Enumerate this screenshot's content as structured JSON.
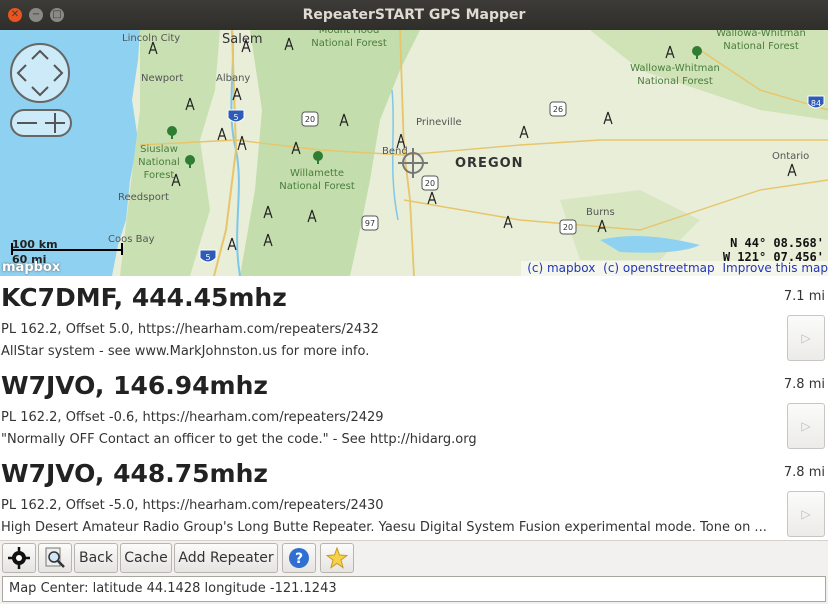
{
  "window": {
    "title": "RepeaterSTART GPS Mapper"
  },
  "map": {
    "labels": {
      "lincoln_city": "Lincoln City",
      "salem": "Salem",
      "newport": "Newport",
      "albany": "Albany",
      "siuslaw": "Siuslaw National Forest",
      "willamette": "Willamette National Forest",
      "mt_hood": "Mount Hood National Forest",
      "wallowa_whitman_top": "Wallowa-Whitman National Forest",
      "wallowa_whitman": "Wallowa-Whitman National Forest",
      "prineville": "Prineville",
      "bend": "Bend",
      "oregon": "OREGON",
      "reedsport": "Reedsport",
      "coos_bay": "Coos Bay",
      "burns": "Burns",
      "ontario": "Ontario"
    },
    "highways": [
      "5",
      "20",
      "26",
      "84",
      "20",
      "97",
      "20",
      "5"
    ],
    "scale_km": "100 km",
    "scale_mi": "60 mi",
    "logo": "mapbox",
    "latitude_text": "N 44° 08.568'",
    "longitude_text": "W 121° 07.456'",
    "attribution": {
      "mapbox": "(c) mapbox",
      "osm": "(c) openstreetmap",
      "improve": "Improve this map"
    }
  },
  "repeaters": [
    {
      "title": "KC7DMF, 444.45mhz",
      "distance": "7.1 mi",
      "info": "PL 162.2, Offset 5.0, https://hearham.com/repeaters/2432",
      "description": "AllStar system - see www.MarkJohnston.us for more info."
    },
    {
      "title": "W7JVO, 146.94mhz",
      "distance": "7.8 mi",
      "info": "PL 162.2, Offset -0.6, https://hearham.com/repeaters/2429",
      "description": "\"Normally OFF Contact an officer to get the code.\" - See http://hidarg.org"
    },
    {
      "title": "W7JVO, 448.75mhz",
      "distance": "7.8 mi",
      "info": "PL 162.2, Offset -5.0, https://hearham.com/repeaters/2430",
      "description": "High Desert Amateur Radio Group's Long Butte Repeater. Yaesu Digital System Fusion experimental mode. Tone on ..."
    }
  ],
  "toolbar": {
    "gps_icon": "crosshair-target-icon",
    "search_icon": "magnifier-icon",
    "back": "Back",
    "cache": "Cache",
    "add_repeater": "Add Repeater",
    "help_icon": "help-icon",
    "star_icon": "star-icon"
  },
  "status": "Map Center: latitude 44.1428 longitude -121.1243",
  "colors": {
    "ocean": "#8fd1f0",
    "land": "#e5ecd3",
    "forest": "#c6dfae",
    "link": "#2236b8",
    "titlebar": "#3c3b37",
    "close": "#e95420"
  }
}
